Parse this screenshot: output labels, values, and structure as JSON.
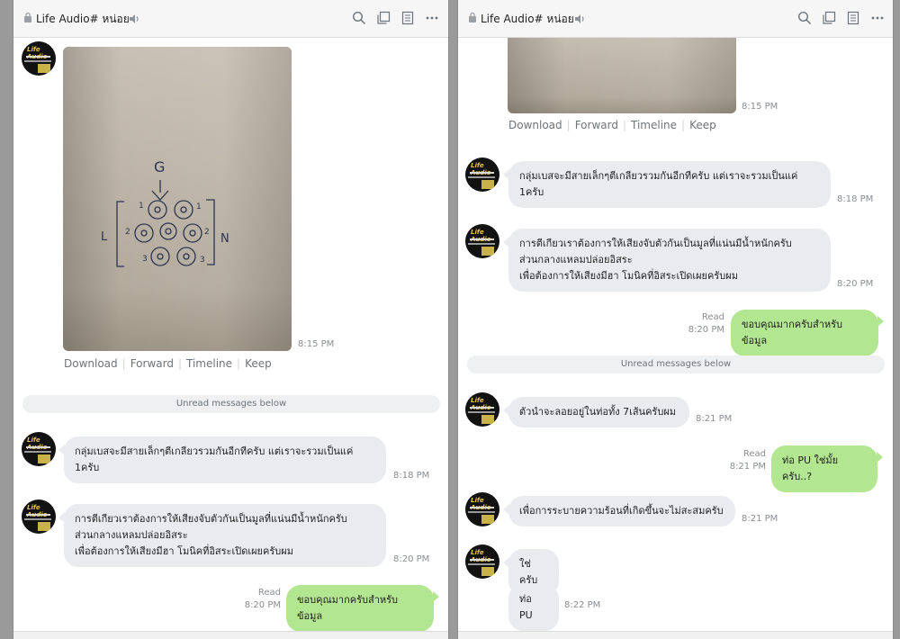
{
  "window": {
    "title": "Life Audio# หน่อย",
    "icons": [
      "lock-icon",
      "speaker-icon",
      "search-icon",
      "copy-icon",
      "notes-icon",
      "more-icon"
    ]
  },
  "colors": {
    "sent_bubble": "#b3e690",
    "received_bubble": "#e9ebee",
    "meta_text": "#8a8d91"
  },
  "image_actions": [
    "Download",
    "Forward",
    "Timeline",
    "Keep"
  ],
  "left_pane": {
    "photo_time": "8:15 PM",
    "unread_label": "Unread messages below",
    "messages": [
      {
        "lines": [
          "กลุ่มเบสจะมีสายเล็กๆตีเกลียวรวมกันอีกทีครับ แต่เราจะรวมเป็นแค่",
          "1ครับ"
        ],
        "time": "8:18 PM"
      },
      {
        "lines": [
          "การตีเกียวเราต้องการให้เสียงจับตัวกันเป็นมูลที่แน่นมีน้ำหนักครับ",
          "ส่วนกลางแหลมปล่อยอิสระ",
          "เพื่อต้องการให้เสียงมีฮา โมนิคที่อิสระเปิดเผยครับผม"
        ],
        "time": "8:20 PM"
      },
      {
        "text": "ขอบคุณมากครับสำหรับข้อมูล",
        "read": "Read",
        "time": "8:20 PM"
      }
    ],
    "drawing_labels": {
      "top": "G",
      "left": "L",
      "right": "N",
      "n1a": "1",
      "n1b": "1",
      "n2a": "2",
      "n2b": "2",
      "n3a": "3",
      "n3b": "3"
    }
  },
  "right_pane": {
    "photo_time": "8:15 PM",
    "unread_label": "Unread messages below",
    "messages": [
      {
        "lines": [
          "กลุ่มเบสจะมีสายเล็กๆตีเกลียวรวมกันอีกทีครับ แต่เราจะรวมเป็นแค่",
          "1ครับ"
        ],
        "time": "8:18 PM"
      },
      {
        "lines": [
          "การตีเกียวเราต้องการให้เสียงจับตัวกันเป็นมูลที่แน่นมีน้ำหนักครับ",
          "ส่วนกลางแหลมปล่อยอิสระ",
          "เพื่อต้องการให้เสียงมีฮา โมนิคที่อิสระเปิดเผยครับผม"
        ],
        "time": "8:20 PM"
      },
      {
        "text": "ขอบคุณมากครับสำหรับข้อมูล",
        "read": "Read",
        "time": "8:20 PM"
      },
      {
        "text": "ตัวนำจะลอยอยู่ในท่อทั้ง 7เส้นครับผม",
        "time": "8:21 PM"
      },
      {
        "text": "ท่อ PU ใช่มั้ยครับ..?",
        "read": "Read",
        "time": "8:21 PM"
      },
      {
        "text": "เพื่อการระบายความร้อนที่เกิดขึ้นจะไม่สะสมครับ",
        "time": "8:21 PM"
      },
      {
        "text": "ใช่ครับ"
      },
      {
        "text": "ท่อ PU",
        "time": "8:22 PM"
      }
    ]
  }
}
